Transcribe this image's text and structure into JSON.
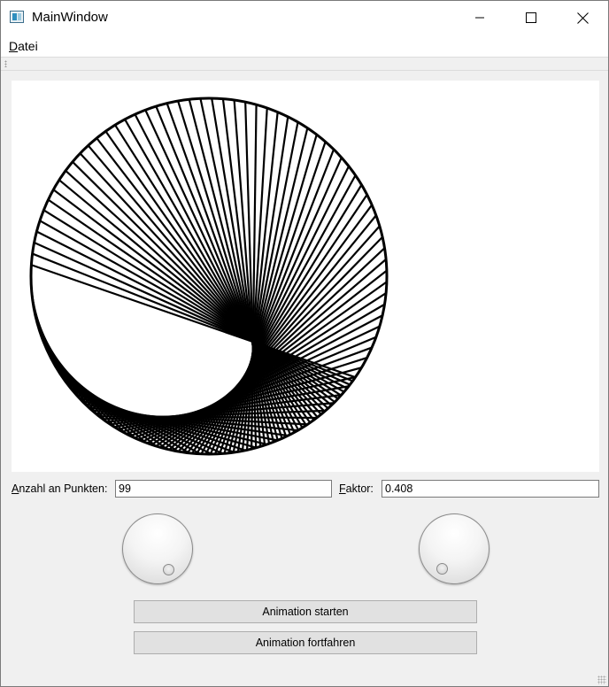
{
  "window": {
    "title": "MainWindow",
    "icon": "app-window-icon",
    "controls": [
      "minimize-icon",
      "maximize-icon",
      "close-icon"
    ]
  },
  "menu": {
    "items": [
      {
        "label": "Datei",
        "mnemonic": "D",
        "rest": "atei"
      }
    ]
  },
  "canvas": {
    "background": "#ffffff",
    "line_color": "#000000",
    "description_points": 99,
    "factor": 0.408
  },
  "controls": {
    "points": {
      "label": "Anzahl an Punkten:",
      "mnemonic": "A",
      "rest": "nzahl an Punkten:",
      "value": "99"
    },
    "factor": {
      "label": "Faktor:",
      "mnemonic": "F",
      "rest": "aktor:",
      "value": "0.408"
    }
  },
  "buttons": {
    "start": "Animation starten",
    "continue": "Animation fortfahren"
  }
}
